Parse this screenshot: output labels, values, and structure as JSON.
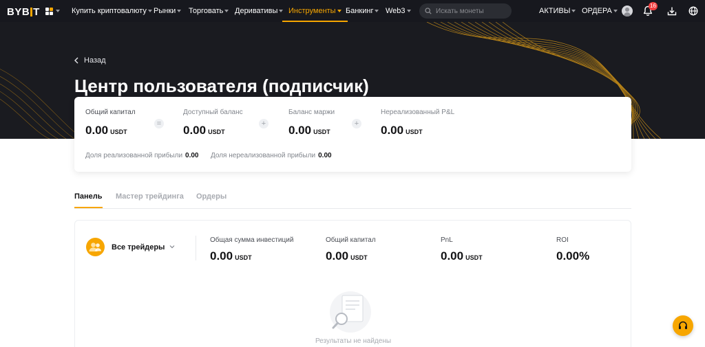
{
  "nav": {
    "logo": "BYBIT",
    "items": [
      {
        "label": "Купить криптовалюту",
        "active": false
      },
      {
        "label": "Рынки",
        "active": false
      },
      {
        "label": "Торговать",
        "active": false
      },
      {
        "label": "Деривативы",
        "active": false
      },
      {
        "label": "Инструменты",
        "active": true
      },
      {
        "label": "Банкинг",
        "active": false
      },
      {
        "label": "Web3",
        "active": false
      }
    ],
    "search_placeholder": "Искать монеты",
    "assets_label": "АКТИВЫ",
    "orders_label": "ОРДЕРА",
    "notification_count": "16"
  },
  "header": {
    "back_label": "Назад",
    "title": "Центр пользователя (подписчик)"
  },
  "summary": {
    "total_equity": {
      "label": "Общий капитал",
      "value": "0.00",
      "unit": "USDT"
    },
    "available_balance": {
      "label": "Доступный баланс",
      "value": "0.00",
      "unit": "USDT"
    },
    "margin_balance": {
      "label": "Баланс маржи",
      "value": "0.00",
      "unit": "USDT"
    },
    "unrealized_pnl": {
      "label": "Нереализованный P&L",
      "value": "0.00",
      "unit": "USDT"
    },
    "operators": [
      "=",
      "+",
      "+"
    ],
    "realized_share": {
      "label": "Доля реализованной прибыли",
      "value": "0.00"
    },
    "unrealized_share": {
      "label": "Доля нереализованной прибыли",
      "value": "0.00"
    }
  },
  "tabs": [
    {
      "label": "Панель",
      "active": true
    },
    {
      "label": "Мастер трейдинга",
      "active": false
    },
    {
      "label": "Ордеры",
      "active": false
    }
  ],
  "panel": {
    "trader_select": "Все трейдеры",
    "stats": [
      {
        "label": "Общая сумма инвестиций",
        "value": "0.00",
        "unit": "USDT"
      },
      {
        "label": "Общий капитал",
        "value": "0.00",
        "unit": "USDT"
      },
      {
        "label": "PnL",
        "value": "0.00",
        "unit": "USDT"
      },
      {
        "label": "ROI",
        "value": "0.00%",
        "unit": ""
      }
    ],
    "empty_text": "Результаты не найдены"
  },
  "colors": {
    "accent": "#f7a600",
    "nav_bg": "#17181e",
    "hero_bg": "#1a1b20",
    "badge": "#f23f3f"
  }
}
